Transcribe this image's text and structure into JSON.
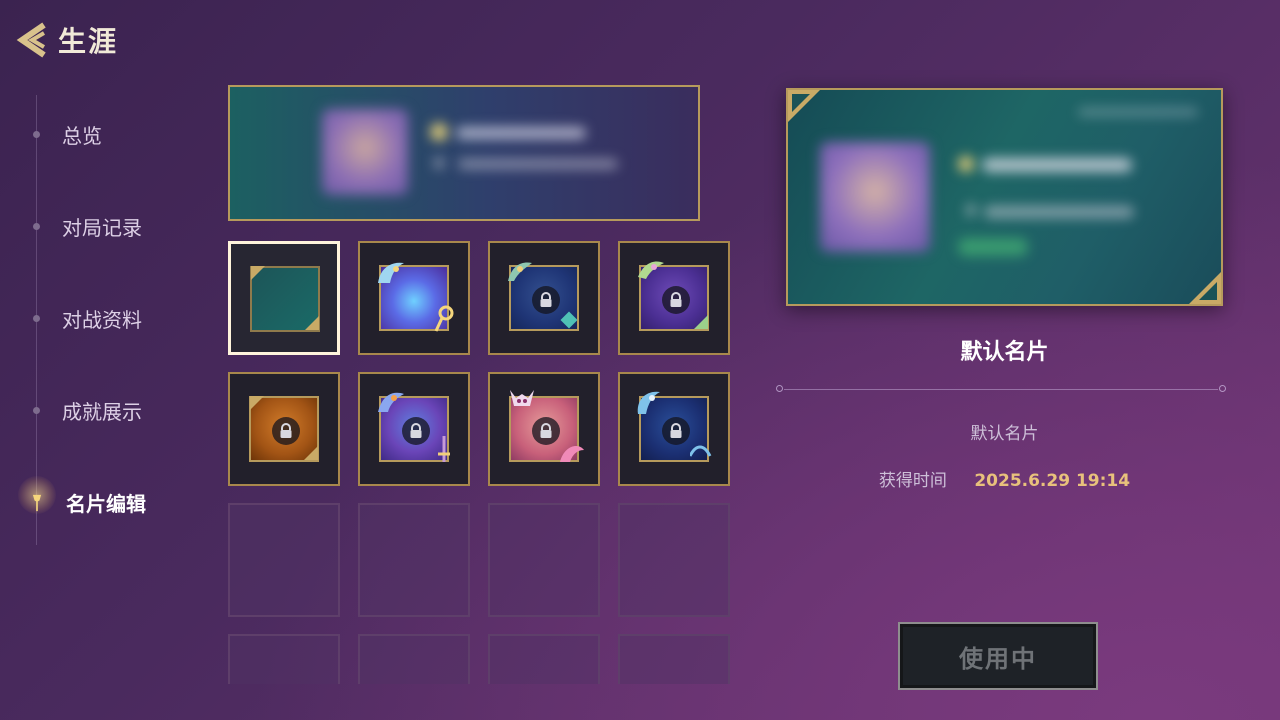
{
  "header": {
    "title": "生涯",
    "back_icon": "back-chevron-icon"
  },
  "sidebar": {
    "items": [
      {
        "label": "总览",
        "active": false
      },
      {
        "label": "对局记录",
        "active": false
      },
      {
        "label": "对战资料",
        "active": false
      },
      {
        "label": "成就展示",
        "active": false
      },
      {
        "label": "名片编辑",
        "active": true,
        "icon": "card-edit-icon"
      }
    ]
  },
  "grid": {
    "cards": [
      {
        "state": "selected",
        "locked": false,
        "theme": "teal"
      },
      {
        "state": "owned",
        "locked": false,
        "theme": "cosmic-blue"
      },
      {
        "state": "owned",
        "locked": true,
        "theme": "navy-gold"
      },
      {
        "state": "owned",
        "locked": true,
        "theme": "violet-cosmic"
      },
      {
        "state": "owned",
        "locked": true,
        "theme": "amber"
      },
      {
        "state": "owned",
        "locked": true,
        "theme": "purple-dragon"
      },
      {
        "state": "owned",
        "locked": true,
        "theme": "pink-fox"
      },
      {
        "state": "owned",
        "locked": true,
        "theme": "deep-blue"
      },
      {
        "state": "empty"
      },
      {
        "state": "empty"
      },
      {
        "state": "empty"
      },
      {
        "state": "empty"
      },
      {
        "state": "empty"
      },
      {
        "state": "empty"
      },
      {
        "state": "empty"
      },
      {
        "state": "empty"
      }
    ]
  },
  "detail": {
    "name": "默认名片",
    "subtitle": "默认名片",
    "acquired_label": "获得时间",
    "acquired_value": "2025.6.29  19:14",
    "button_label": "使用中"
  },
  "colors": {
    "gold": "#b69a5c",
    "accent_time": "#e8c17c",
    "bg": "#4a2a5e"
  }
}
